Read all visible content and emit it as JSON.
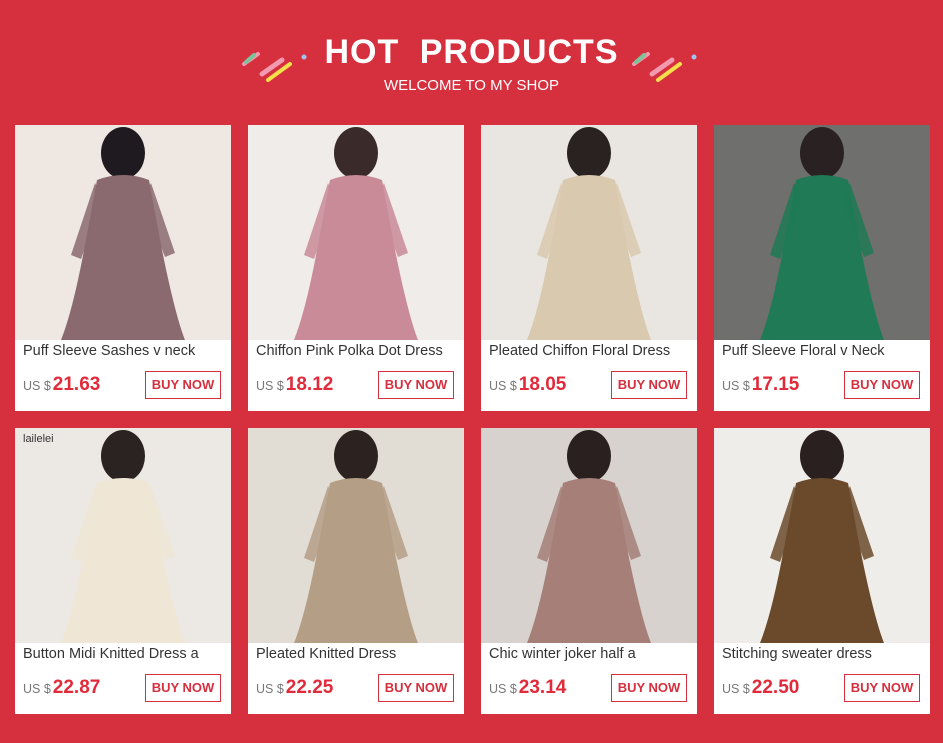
{
  "header": {
    "title": "HOT  PRODUCTS",
    "subtitle": "WELCOME TO MY SHOP"
  },
  "currency": "US $",
  "buy_label": "BUY NOW",
  "colors": {
    "background": "#d62f3e",
    "price": "#e12a3a",
    "accent": "#d62f3e"
  },
  "products": [
    {
      "name": "Puff Sleeve Sashes v neck",
      "price": "21.63",
      "photo_palette": [
        "#efe7e2",
        "#8a6a6f",
        "#1e1a1f"
      ]
    },
    {
      "name": "Chiffon Pink Polka Dot Dress",
      "price": "18.12",
      "photo_palette": [
        "#f0ece9",
        "#c98b98",
        "#3b2a2a"
      ]
    },
    {
      "name": "Pleated Chiffon Floral Dress",
      "price": "18.05",
      "photo_palette": [
        "#e9e6e1",
        "#d9c9ae",
        "#2a2220"
      ]
    },
    {
      "name": "Puff Sleeve Floral v Neck",
      "price": "17.15",
      "photo_palette": [
        "#6f6f6d",
        "#1f7a55",
        "#2a2222"
      ]
    },
    {
      "name": "Button Midi Knitted Dress a",
      "price": "22.87",
      "photo_palette": [
        "#ece9e4",
        "#efe6d6",
        "#2b2322"
      ],
      "brand": "lailelei"
    },
    {
      "name": "Pleated Knitted Dress",
      "price": "22.25",
      "photo_palette": [
        "#e1dcd4",
        "#b49e86",
        "#2c2220"
      ]
    },
    {
      "name": "Chic winter joker half a",
      "price": "23.14",
      "photo_palette": [
        "#d7d2cd",
        "#a57f78",
        "#2a2020"
      ]
    },
    {
      "name": "Stitching sweater dress",
      "price": "22.50",
      "photo_palette": [
        "#efede9",
        "#6b4a2c",
        "#2a2020"
      ]
    }
  ]
}
